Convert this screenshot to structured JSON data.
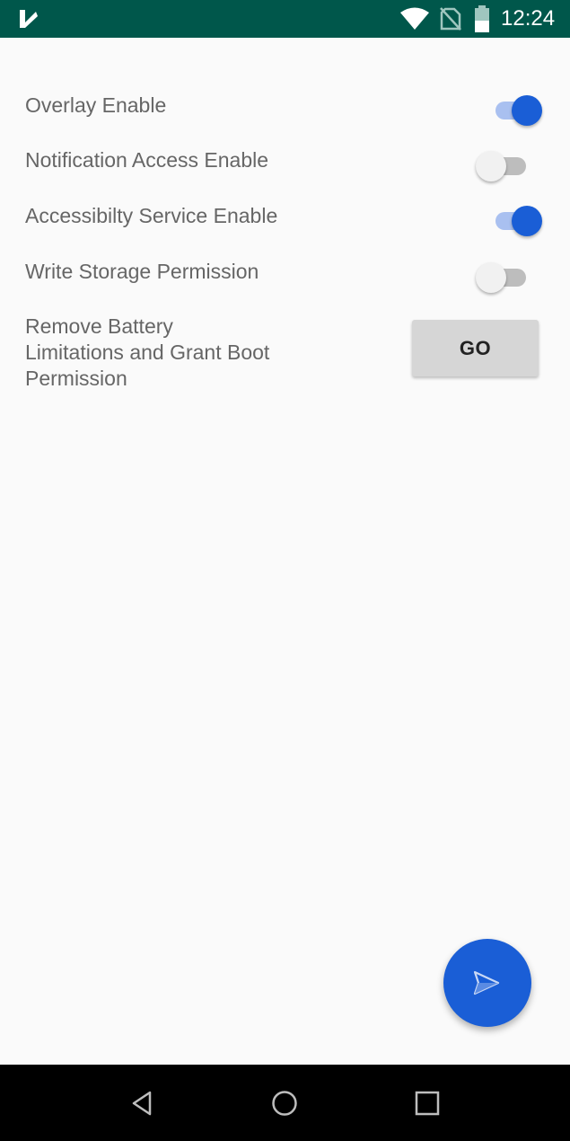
{
  "status_bar": {
    "time": "12:24",
    "background": "#00574b",
    "icons": [
      "app-icon",
      "wifi-icon",
      "no-sim-icon",
      "battery-icon"
    ]
  },
  "settings": [
    {
      "label": "Overlay Enable",
      "state": "on"
    },
    {
      "label": "Notification Access Enable",
      "state": "off"
    },
    {
      "label": "Accessibilty Service Enable",
      "state": "on"
    },
    {
      "label": "Write Storage Permission",
      "state": "off"
    }
  ],
  "battery_row": {
    "label_line1": "Remove Battery",
    "label_line2": "Limitations and Grant Boot",
    "label_line3": "Permission",
    "button_label": "GO"
  },
  "fab": {
    "icon": "send-icon",
    "color": "#1a5ed6"
  },
  "nav_bar": {
    "icons": [
      "back-icon",
      "home-icon",
      "recents-icon"
    ]
  },
  "colors": {
    "accent": "#1a5ed6",
    "track_on": "#a9c0f0",
    "text": "#666666"
  }
}
